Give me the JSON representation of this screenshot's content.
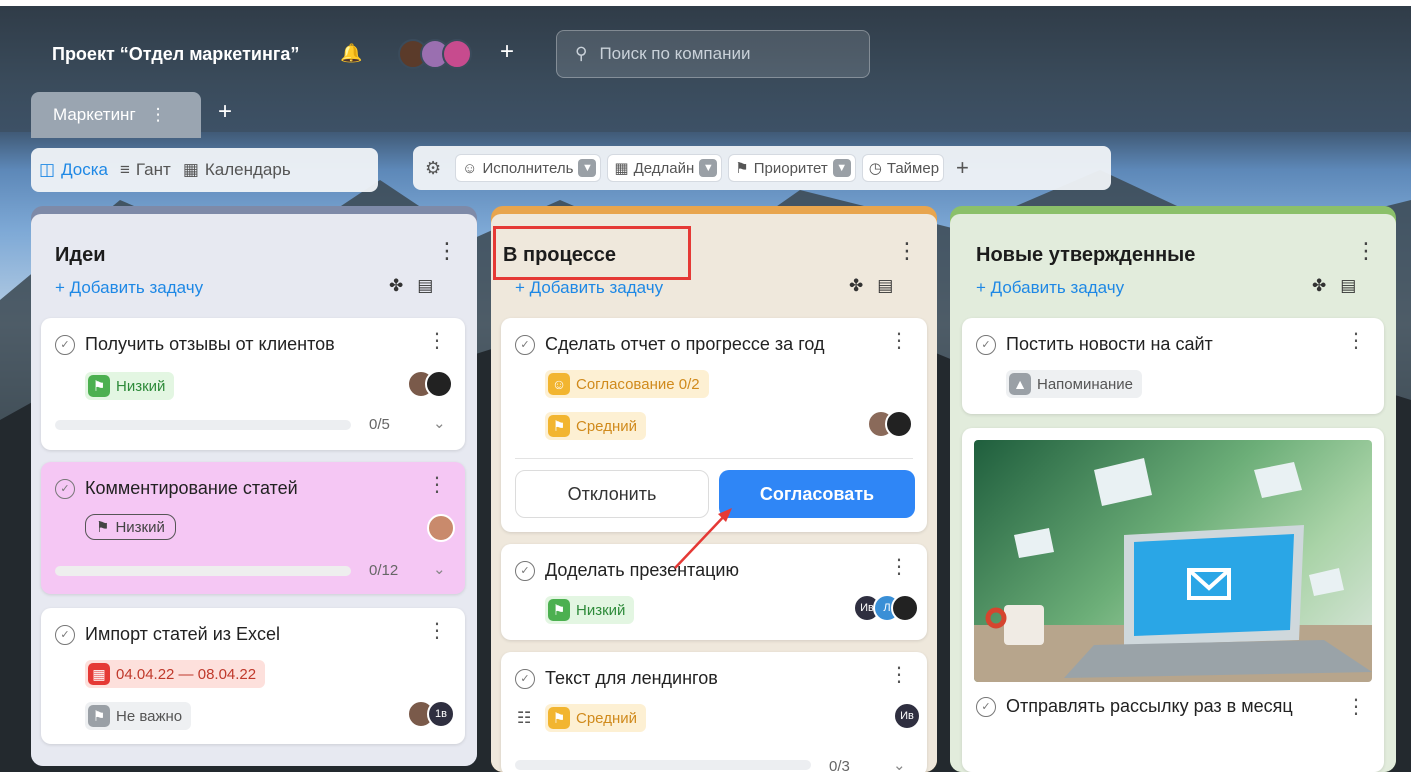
{
  "header": {
    "project_title": "Проект “Отдел маркетинга”",
    "search_placeholder": "Поиск по компании"
  },
  "tabs": [
    {
      "label": "Маркетинг"
    }
  ],
  "views": [
    {
      "label": "Доска",
      "active": true
    },
    {
      "label": "Гант"
    },
    {
      "label": "Календарь"
    }
  ],
  "filters": [
    {
      "label": "Исполнитель"
    },
    {
      "label": "Дедлайн"
    },
    {
      "label": "Приоритет"
    },
    {
      "label": "Таймер"
    }
  ],
  "add_task_label": "+ Добавить задачу",
  "columns": [
    {
      "title": "Идеи",
      "color": "#7e8aa8",
      "cards": [
        {
          "title": "Получить отзывы от клиентов",
          "priority": "Низкий",
          "progress": "0/5"
        },
        {
          "title": "Комментирование статей",
          "priority": "Низкий",
          "progress": "0/12",
          "bg": "#f5c7f4"
        },
        {
          "title": "Импорт статей из Excel",
          "date": "04.04.22 — 08.04.22",
          "priority": "Не важно",
          "avatar_text": "1в"
        }
      ]
    },
    {
      "title": "В процессе",
      "color": "#e8a54e",
      "cards": [
        {
          "title": "Сделать отчет о прогрессе за год",
          "approval": "Согласование 0/2",
          "priority": "Средний",
          "reject": "Отклонить",
          "approve": "Согласовать"
        },
        {
          "title": "Доделать презентацию",
          "priority": "Низкий",
          "avatar_text": "Ив",
          "avatar_text2": "Л"
        },
        {
          "title": "Текст для лендингов",
          "priority": "Средний",
          "avatar_text": "Ив",
          "progress": "0/3"
        }
      ]
    },
    {
      "title": "Новые утвержденные",
      "color": "#8bc06a",
      "cards": [
        {
          "title": "Постить новости на сайт",
          "reminder": "Напоминание"
        },
        {
          "title": "Отправлять рассылку раз в месяц"
        }
      ]
    }
  ]
}
